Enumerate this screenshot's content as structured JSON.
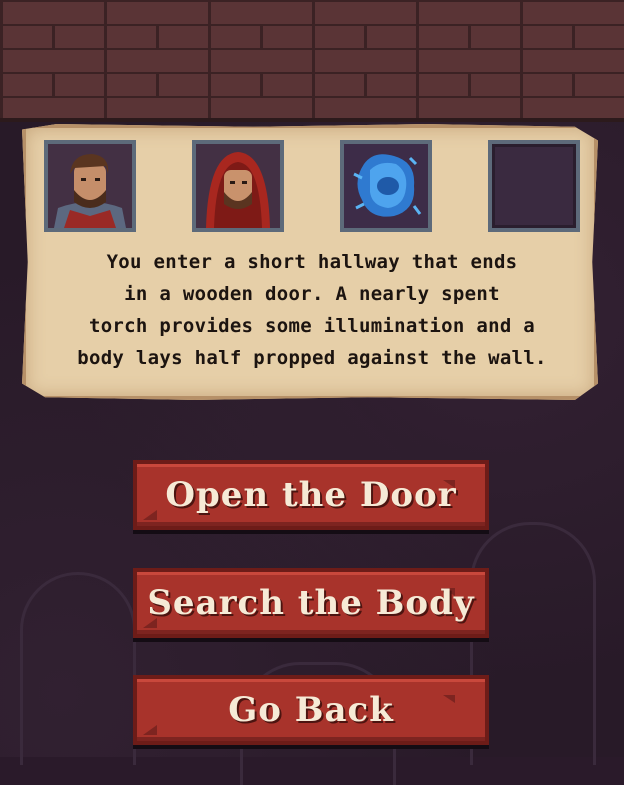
{
  "party": [
    {
      "name": "warrior-portrait",
      "icon": "bearded-man-icon"
    },
    {
      "name": "red-hood-portrait",
      "icon": "red-hooded-man-icon"
    },
    {
      "name": "wisp-portrait",
      "icon": "blue-wisp-icon"
    },
    {
      "name": "empty-portrait-slot",
      "icon": ""
    }
  ],
  "story": {
    "lines": [
      "You enter a short hallway that ends",
      "in a wooden door. A nearly spent",
      "torch provides some illumination and a",
      "body lays half propped against the wall."
    ]
  },
  "choices": {
    "open_door": "Open the Door",
    "search_body": "Search the Body",
    "go_back": "Go Back"
  },
  "colors": {
    "parchment": "#e6cfa8",
    "button": "#a8332b",
    "brick": "#5a3436",
    "background": "#281a28"
  }
}
